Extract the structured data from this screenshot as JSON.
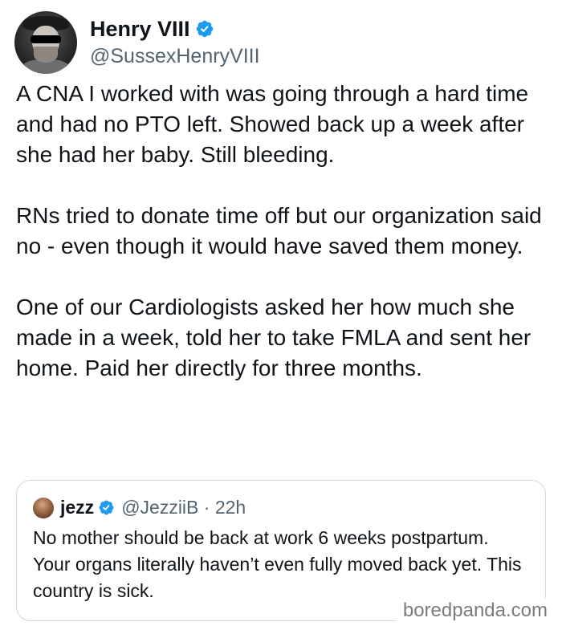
{
  "tweet": {
    "author": {
      "display_name": "Henry VIII",
      "handle": "@SussexHenryVIII",
      "verified_icon": "verified-badge-icon",
      "verified_color": "#1d9bf0"
    },
    "paragraphs": [
      "A CNA I worked with was going through a hard time and had no PTO left. Showed back up a week after she had her baby. Still bleeding.",
      "RNs tried to donate time off but our organization said no - even though it would have saved them money.",
      "One of our Cardiologists asked her how much she made in a week, told her to take FMLA and sent her home. Paid her directly for three months."
    ]
  },
  "quote": {
    "display_name": "jezz",
    "handle_time": "@JezziiB · 22h",
    "verified_icon": "verified-badge-icon",
    "text": "No mother should be back at work 6 weeks postpartum. Your organs literally haven’t even fully moved back yet. This country is sick."
  },
  "watermark": "boredpanda.com"
}
